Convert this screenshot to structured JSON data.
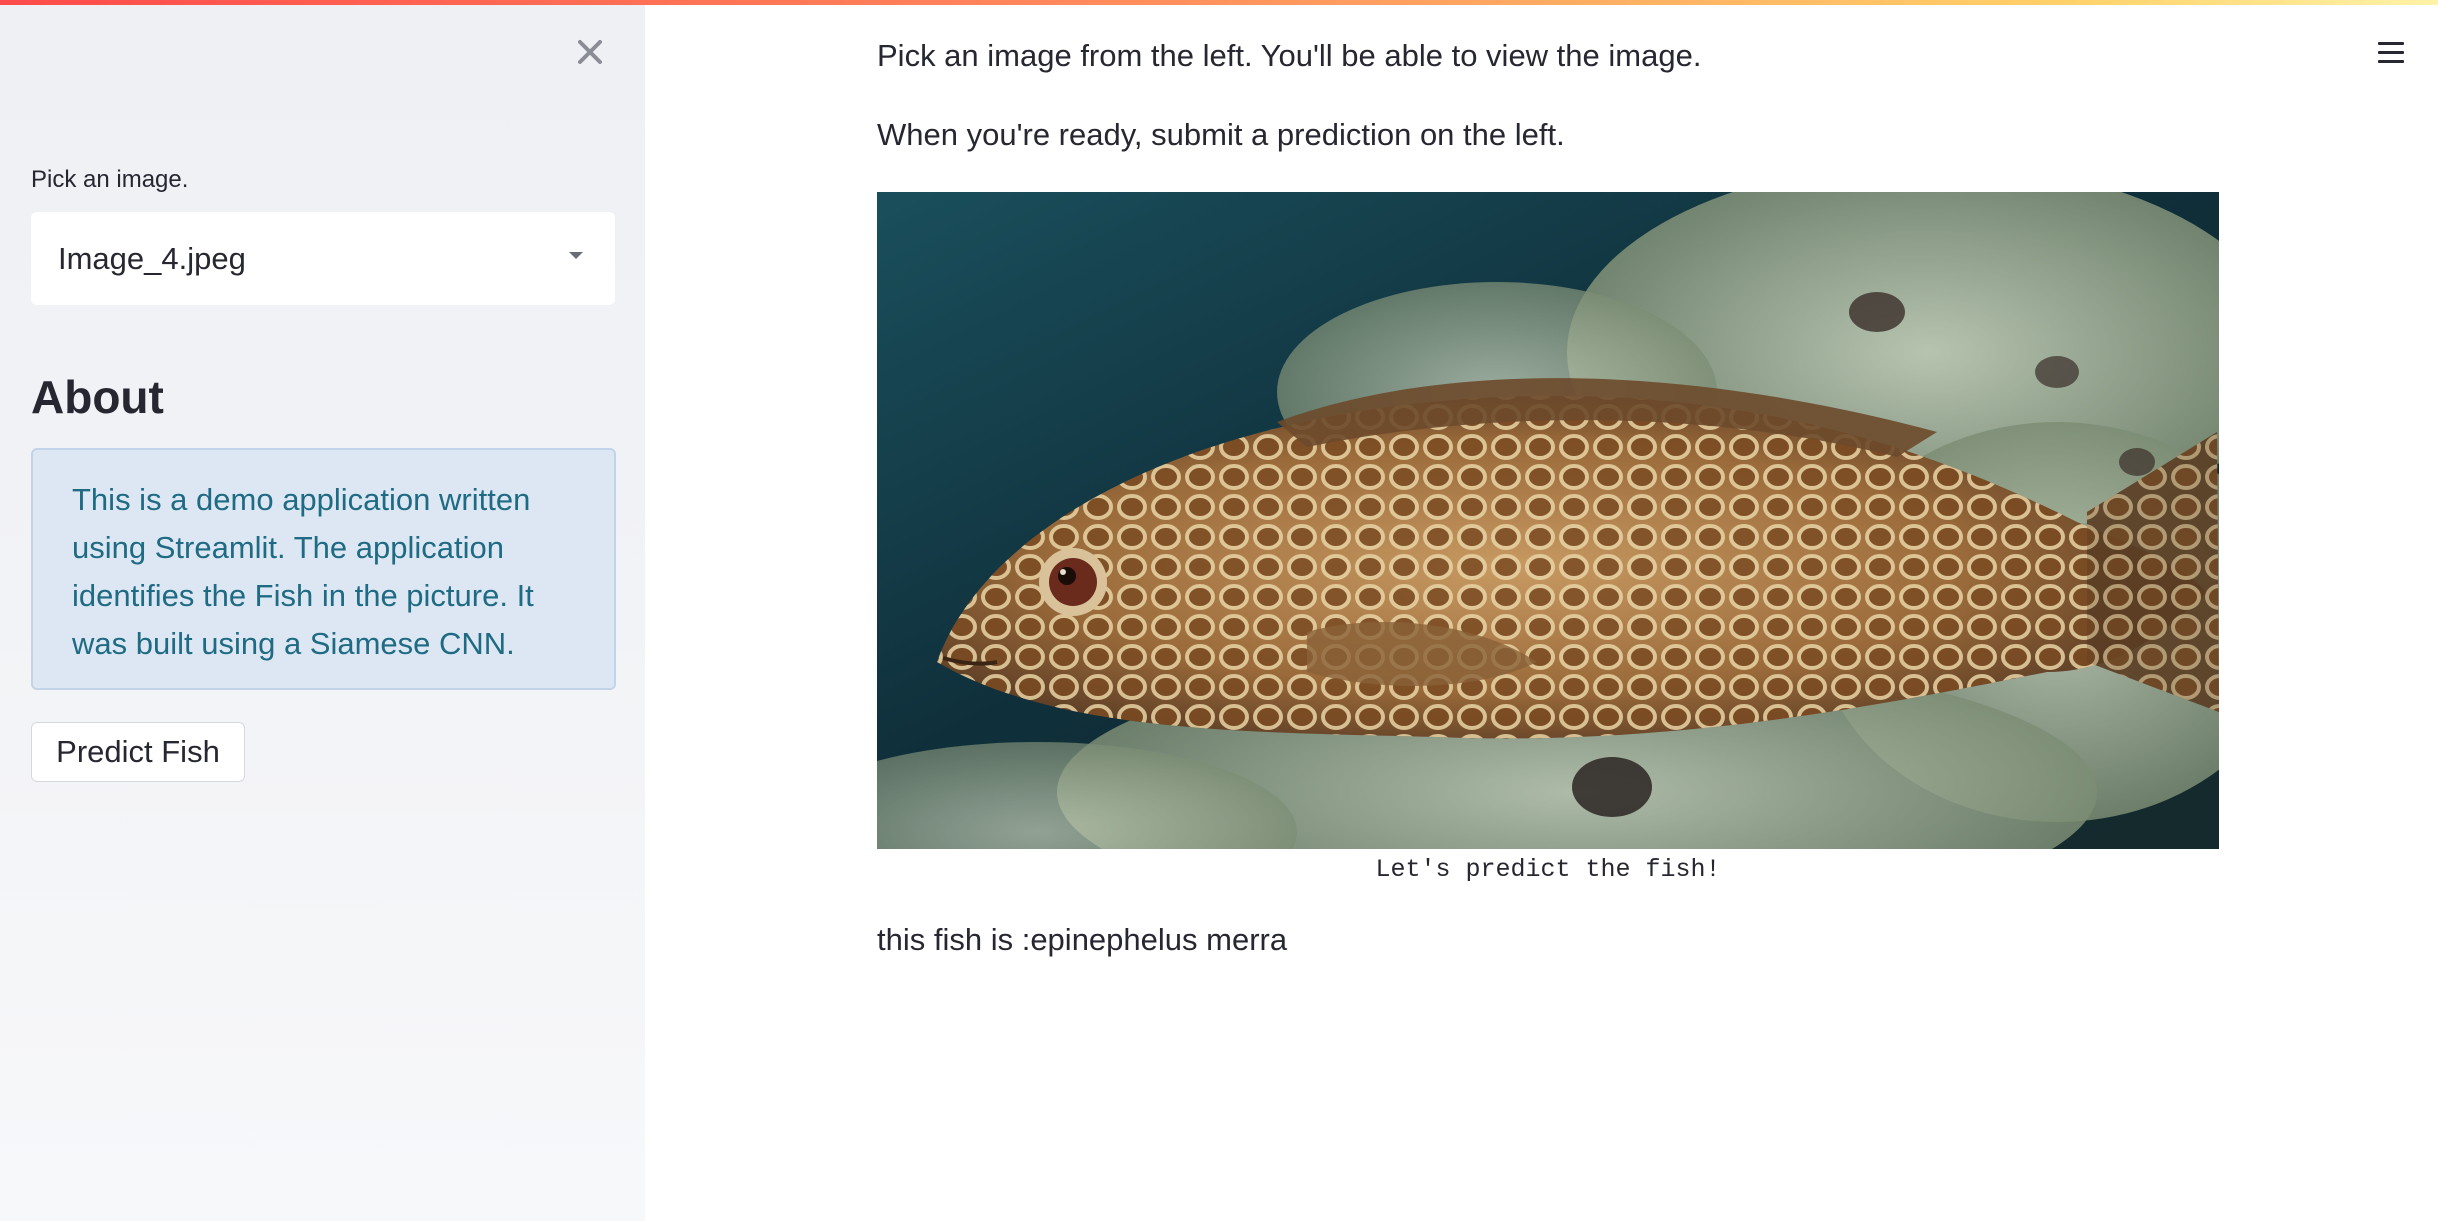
{
  "sidebar": {
    "close_icon": "close-icon",
    "select": {
      "label": "Pick an image.",
      "value": "Image_4.jpeg",
      "caret_icon": "chevron-down-icon"
    },
    "about": {
      "heading": "About",
      "info_text": "This is a demo application written using Streamlit. The application identifies the Fish in the picture. It was built using a Siamese CNN."
    },
    "predict_button_label": "Predict Fish"
  },
  "main": {
    "instruction_1": "Pick an image from the left. You'll be able to view the image.",
    "instruction_2": "When you're ready, submit a prediction on the left.",
    "image_caption": "Let's predict the fish!",
    "prediction": "this fish is :epinephelus merra",
    "menu_icon": "hamburger-menu-icon"
  },
  "colors": {
    "accent_gradient_start": "#ff4b4b",
    "accent_gradient_end": "#fff3a8",
    "info_background": "#dde7f3",
    "info_text": "#1e6b83",
    "text": "#262730"
  }
}
